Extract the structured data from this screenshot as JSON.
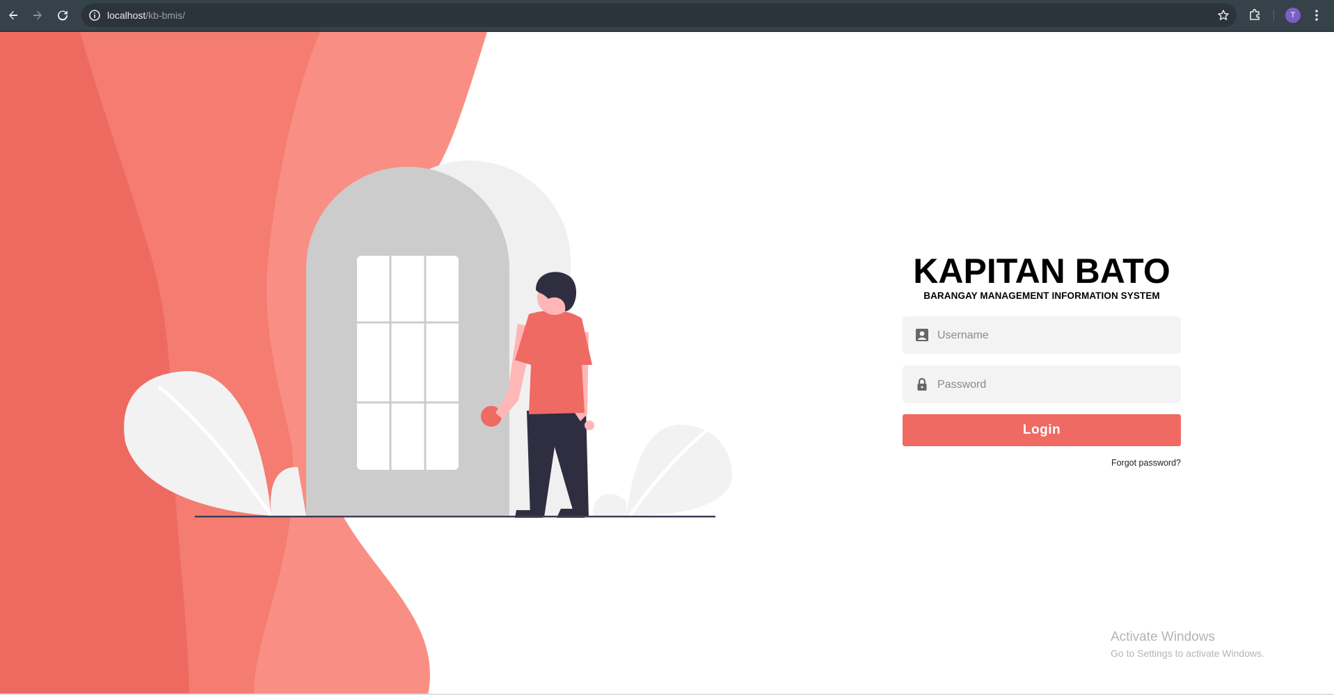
{
  "browser": {
    "url_host": "localhost",
    "url_path": "/kb-bmis/",
    "profile_initial": "T",
    "icons": [
      "back-icon",
      "forward-icon",
      "reload-icon",
      "site-info-icon",
      "bookmark-star-icon",
      "extensions-icon",
      "avatar",
      "menu-icon"
    ]
  },
  "login": {
    "title": "KAPITAN BATO",
    "subtitle": "BARANGAY MANAGEMENT INFORMATION SYSTEM",
    "username_placeholder": "Username",
    "password_placeholder": "Password",
    "login_label": "Login",
    "forgot_label": "Forgot password?"
  },
  "windows_watermark": {
    "title": "Activate Windows",
    "subtitle": "Go to Settings to activate Windows."
  },
  "colors": {
    "accent": "#ef6a62",
    "accent_light": "#f98f84",
    "wave_dark": "#ee6a61",
    "door": "#cccccc",
    "pants": "#2f2e41"
  }
}
